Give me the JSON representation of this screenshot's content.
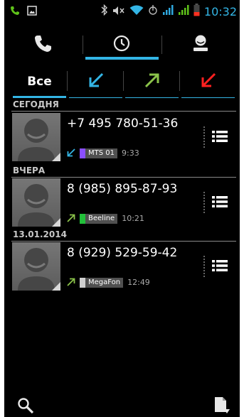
{
  "status_bar": {
    "time": "10:32",
    "icons": [
      "phone-call-icon",
      "image-icon",
      "bluetooth-icon",
      "mute-icon",
      "wifi-icon",
      "usb-icon",
      "signal-icon",
      "signal-icon",
      "battery-icon"
    ]
  },
  "main_tabs": [
    {
      "icon": "phone-icon",
      "selected": false
    },
    {
      "icon": "clock-icon",
      "selected": true
    },
    {
      "icon": "contact-icon",
      "selected": false
    }
  ],
  "filters": {
    "all_label": "Все",
    "items": [
      {
        "id": "all",
        "icon": null,
        "selected": true
      },
      {
        "id": "incoming",
        "icon": "incoming-arrow-icon",
        "color": "#33b5e5"
      },
      {
        "id": "outgoing",
        "icon": "outgoing-arrow-icon",
        "color": "#8bc34a"
      },
      {
        "id": "missed",
        "icon": "missed-arrow-icon",
        "color": "#ff2020"
      }
    ]
  },
  "sections": {
    "today": "СЕГОДНЯ",
    "yesterday": "ВЧЕРА",
    "date": "13.01.2014"
  },
  "calls": [
    {
      "number": "+7 495 780-51-36",
      "direction": "incoming",
      "sim": "MTS 01",
      "sim_color": "#8a4fff",
      "time": "9:33"
    },
    {
      "number": "8 (985) 895-87-93",
      "direction": "outgoing",
      "sim": "Beeline",
      "sim_color": "#22c03a",
      "time": "10:21"
    },
    {
      "number": "8 (929) 529-59-42",
      "direction": "outgoing",
      "sim": "MegaFon",
      "sim_color": "#cfcfcf",
      "time": "12:49"
    }
  ],
  "bottom": {
    "left_icon": "search-icon",
    "right_icon": "dialpad-doc-icon"
  },
  "colors": {
    "accent": "#33b5e5",
    "incoming": "#33b5e5",
    "outgoing": "#8bc34a",
    "missed": "#ff2020"
  }
}
